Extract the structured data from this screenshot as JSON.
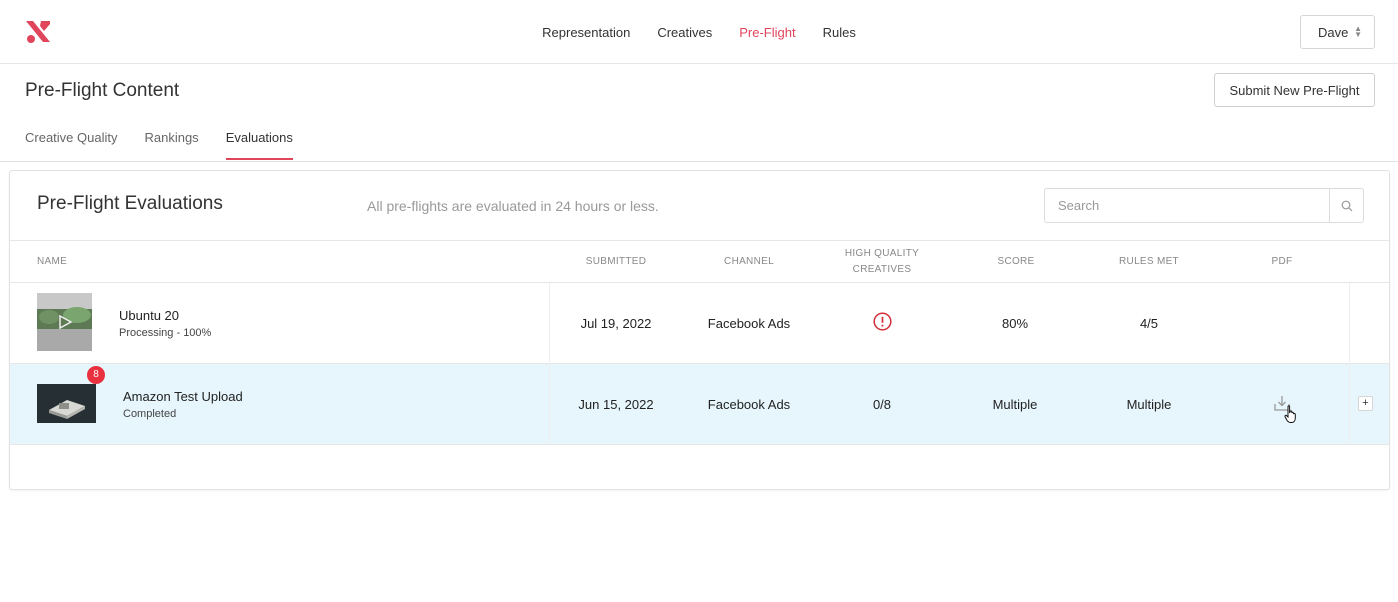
{
  "colors": {
    "accent": "#e0455b",
    "highlight_row": "#e6f6fc",
    "badge": "#e8303f",
    "warning": "#d32f3a"
  },
  "topbar": {
    "logo": "brand-x-logo",
    "nav": [
      {
        "label": "Representation",
        "active": false
      },
      {
        "label": "Creatives",
        "active": false
      },
      {
        "label": "Pre-Flight",
        "active": true
      },
      {
        "label": "Rules",
        "active": false
      }
    ],
    "user": "Dave"
  },
  "subheader": {
    "title": "Pre-Flight Content",
    "submit_label": "Submit New Pre-Flight",
    "tabs": [
      {
        "label": "Creative Quality",
        "active": false
      },
      {
        "label": "Rankings",
        "active": false
      },
      {
        "label": "Evaluations",
        "active": true
      }
    ]
  },
  "card": {
    "title": "Pre-Flight Evaluations",
    "subtitle": "All pre-flights are evaluated in 24 hours or less.",
    "search": {
      "placeholder": "Search",
      "value": "",
      "icon": "search-icon"
    },
    "columns": {
      "name": "NAME",
      "submitted": "SUBMITTED",
      "channel": "CHANNEL",
      "hq_line1": "HIGH QUALITY",
      "hq_line2": "CREATIVES",
      "score": "SCORE",
      "rules_met": "RULES MET",
      "pdf": "PDF"
    },
    "rows": [
      {
        "name": "Ubuntu 20",
        "status": "Processing - 100%",
        "submitted": "Jul 19, 2022",
        "channel": "Facebook Ads",
        "hq_icon": "alert-circle-icon",
        "score": "80%",
        "rules_met": "4/5"
      },
      {
        "name": "Amazon Test Upload",
        "status": "Completed",
        "badge": "8",
        "submitted": "Jun 15, 2022",
        "channel": "Facebook Ads",
        "hq": "0/8",
        "score": "Multiple",
        "rules_met": "Multiple",
        "pdf_icon": "download-icon",
        "expand_label": "+"
      }
    ]
  }
}
